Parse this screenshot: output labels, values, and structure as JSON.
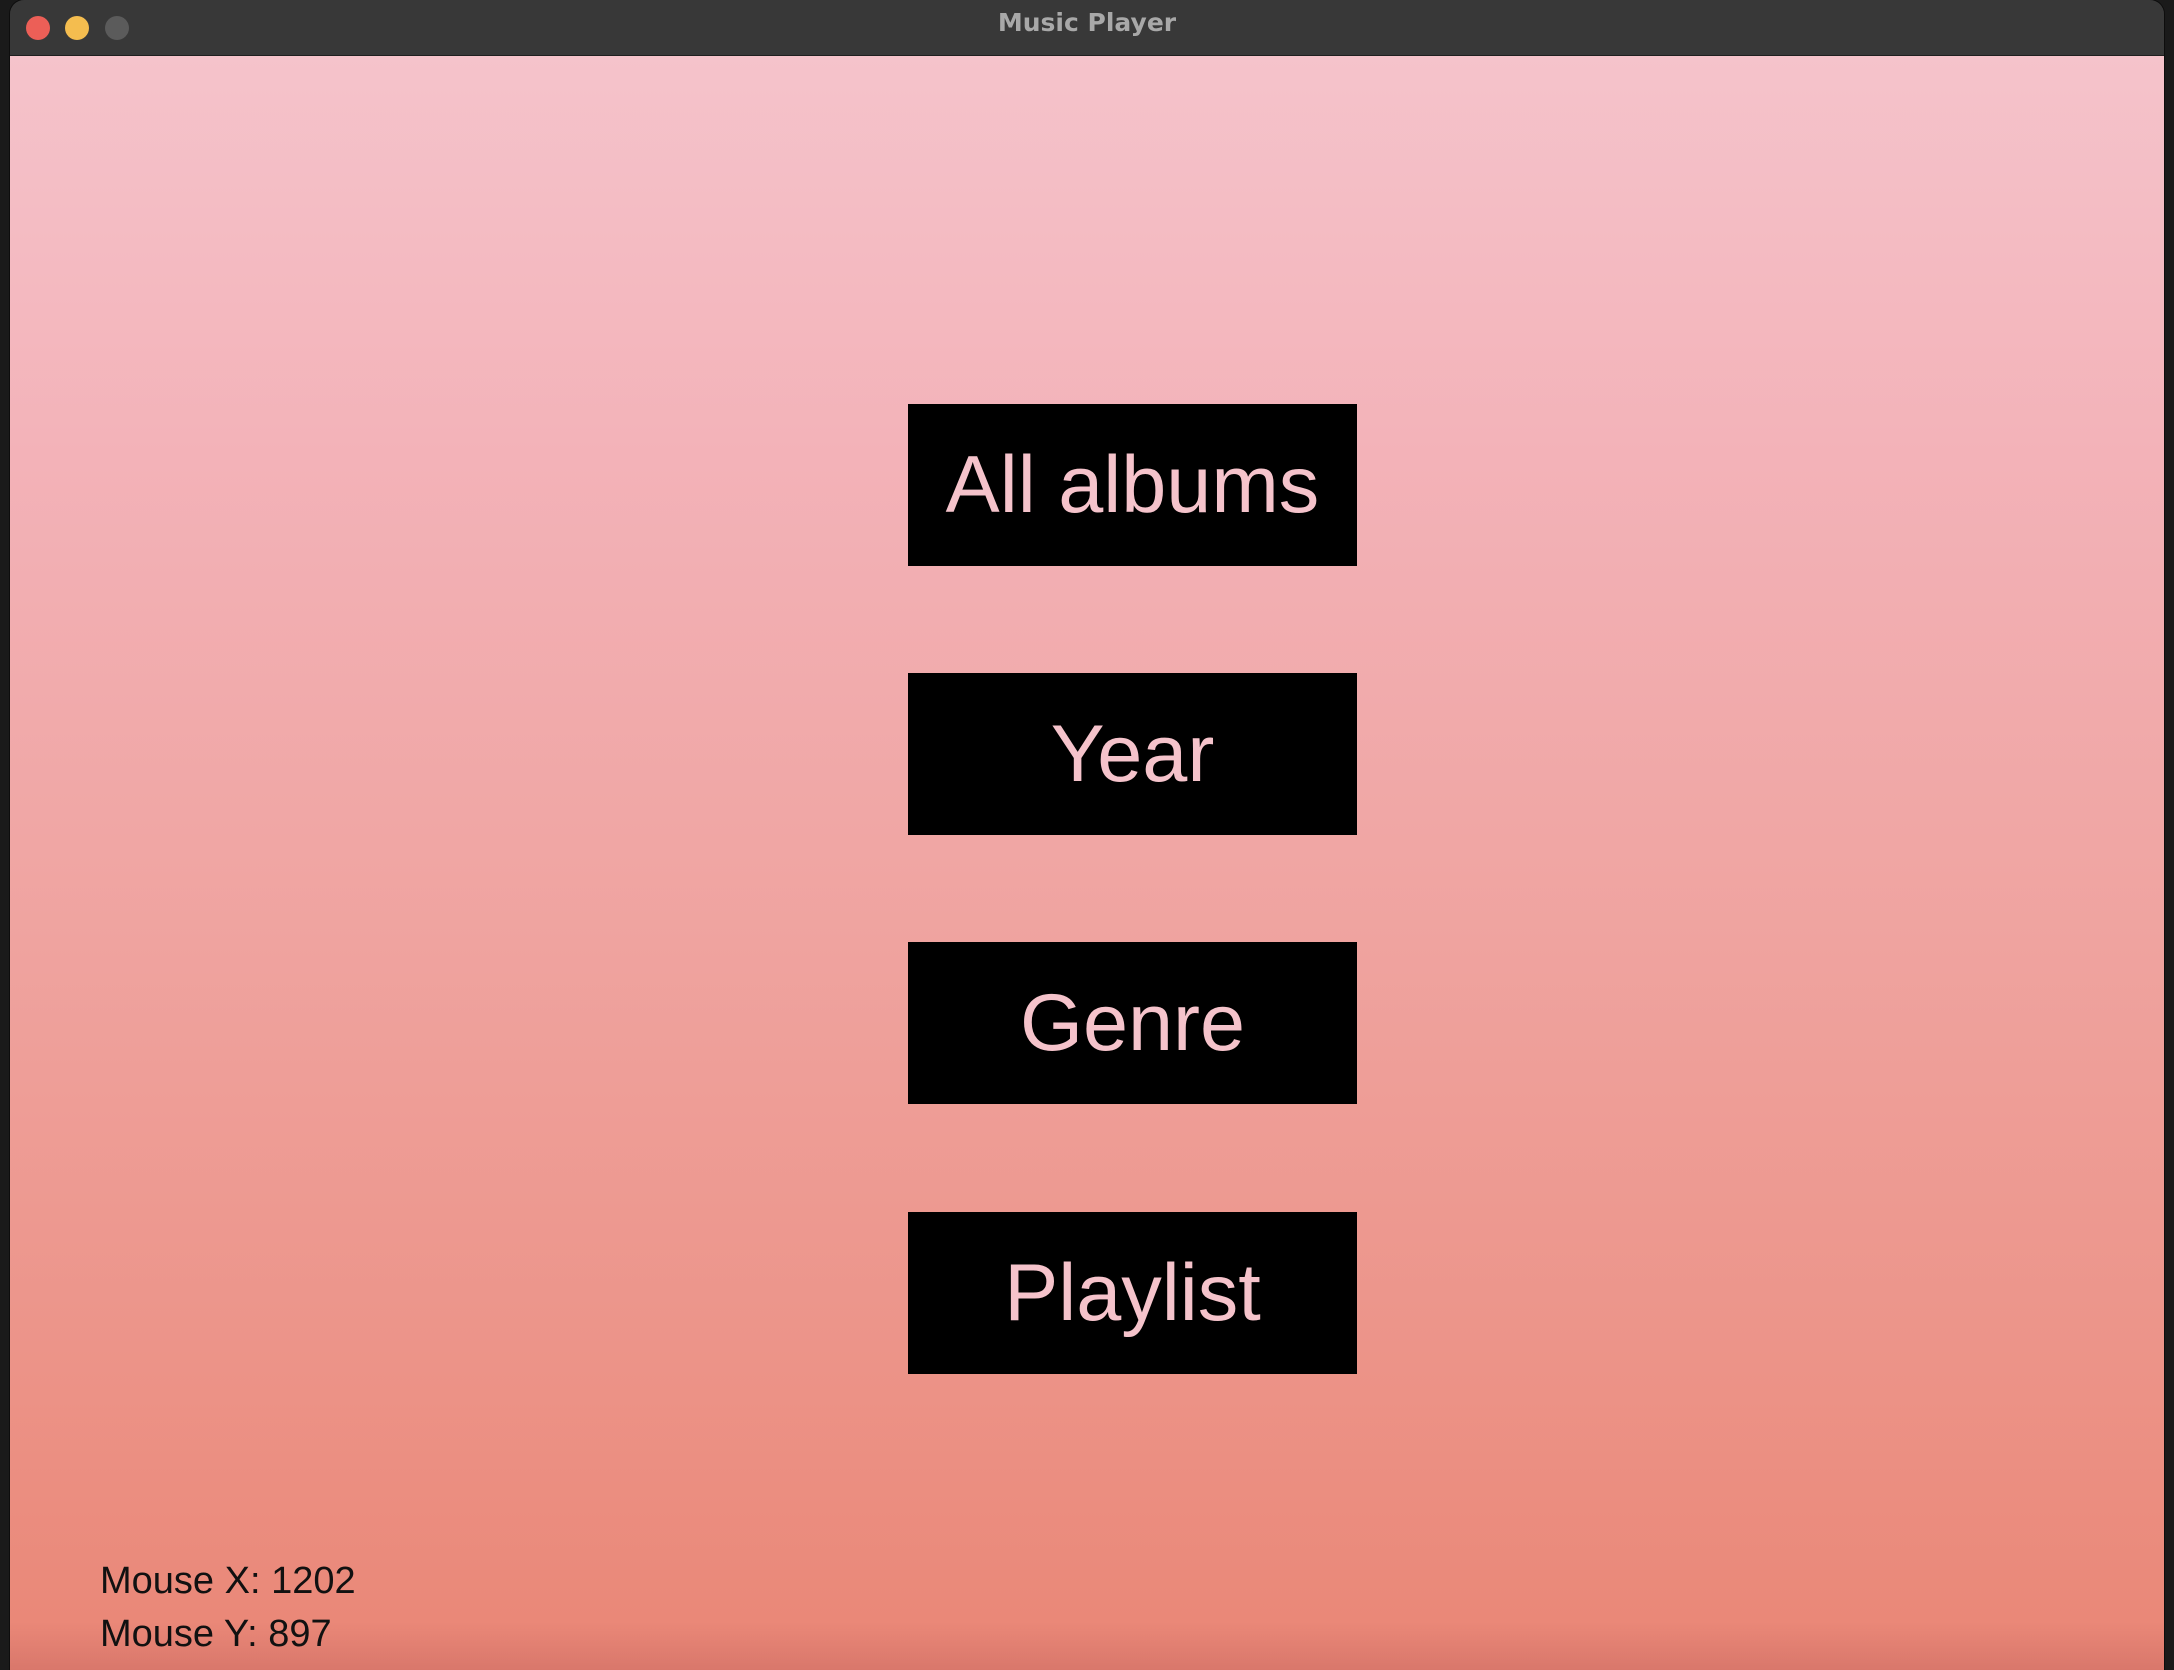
{
  "window": {
    "title": "Music Player",
    "controls": [
      {
        "name": "close",
        "color": "#ec5f57"
      },
      {
        "name": "minimize",
        "color": "#f4bd4f"
      },
      {
        "name": "zoom",
        "color": "#5b5b5b"
      }
    ]
  },
  "menu": {
    "buttons": [
      {
        "label": "All albums"
      },
      {
        "label": "Year"
      },
      {
        "label": "Genre"
      },
      {
        "label": "Playlist"
      }
    ]
  },
  "status": {
    "mouse_x": "Mouse X: 1202",
    "mouse_y": "Mouse Y: 897"
  },
  "colors": {
    "button_background": "#000000",
    "button_text": "#f5c3cb",
    "gradient_top": "#f5c3cb",
    "gradient_bottom": "#ea8878",
    "titlebar": "#383838"
  }
}
